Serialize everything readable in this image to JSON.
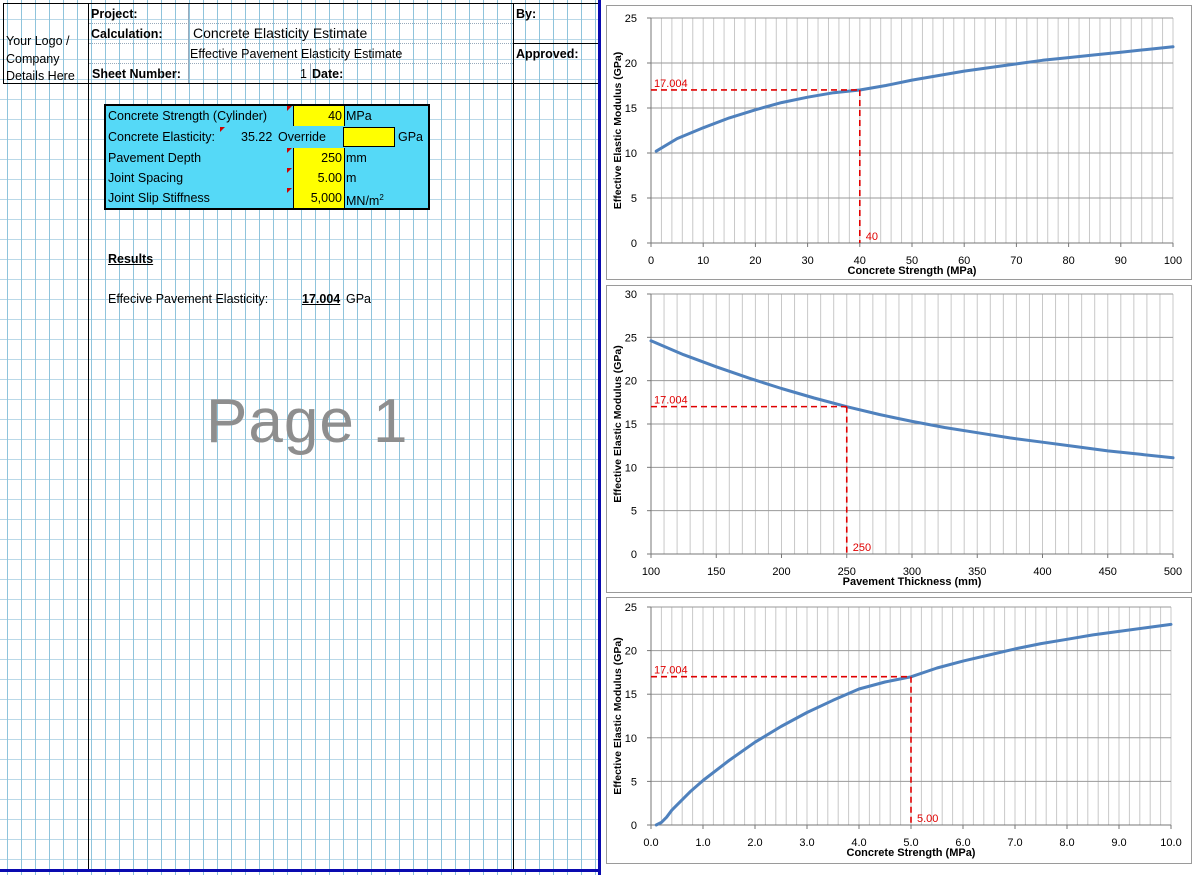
{
  "header": {
    "project_label": "Project:",
    "calculation_label": "Calculation:",
    "calculation_value": "Concrete Elasticity Estimate",
    "subtitle": "Effective Pavement Elasticity Estimate",
    "sheet_number_label": "Sheet Number:",
    "sheet_number_value": "1",
    "date_label": "Date:",
    "by_label": "By:",
    "approved_label": "Approved:",
    "logo_line1": "Your Logo /",
    "logo_line2": "Company",
    "logo_line3": "Details Here"
  },
  "inputs": {
    "rows": [
      {
        "label": "Concrete Strength (Cylinder)",
        "value": "40",
        "unit": "MPa"
      },
      {
        "label": "Concrete Elasticity:",
        "computed": "35.22",
        "override_label": "Override",
        "value": "",
        "unit": "GPa"
      },
      {
        "label": "Pavement Depth",
        "value": "250",
        "unit": "mm"
      },
      {
        "label": "Joint Spacing",
        "value": "5.00",
        "unit": "m"
      },
      {
        "label": "Joint Slip Stiffness",
        "value": "5,000",
        "unit": "MN/m",
        "unit_sup": "2"
      }
    ]
  },
  "results": {
    "heading": "Results",
    "label": "Effecive Pavement Elasticity:",
    "value": "17.004",
    "unit": "GPa"
  },
  "watermark": "Page 1",
  "colors": {
    "input_box": "#55d9f7",
    "input_cell": "#ffff00",
    "sheet_border": "#0a0ab0",
    "series_line": "#4f81bd",
    "marker_line": "#e00000"
  },
  "chart_data": [
    {
      "type": "line",
      "xlabel": "Concrete Strength (MPa)",
      "ylabel": "Effective Elastic Modulus  (GPa)",
      "xlim": [
        0,
        100
      ],
      "ylim": [
        0,
        25
      ],
      "xticks": [
        0,
        10,
        20,
        30,
        40,
        50,
        60,
        70,
        80,
        90,
        100
      ],
      "xtick_labels": [
        "0",
        "10",
        "20",
        "30",
        "40",
        "50",
        "60",
        "70",
        "80",
        "90",
        "100"
      ],
      "yticks": [
        0,
        5,
        10,
        15,
        20,
        25
      ],
      "ytick_labels": [
        "0",
        "5",
        "10",
        "15",
        "20",
        "25"
      ],
      "x_minor_step": 2,
      "series": [
        {
          "x": [
            1,
            5,
            10,
            15,
            20,
            25,
            30,
            35,
            40,
            45,
            50,
            55,
            60,
            65,
            70,
            75,
            80,
            85,
            90,
            95,
            100
          ],
          "y": [
            10.2,
            11.6,
            12.8,
            13.9,
            14.8,
            15.6,
            16.2,
            16.7,
            17.0,
            17.5,
            18.1,
            18.6,
            19.1,
            19.5,
            19.9,
            20.3,
            20.6,
            20.9,
            21.2,
            21.5,
            21.8
          ]
        }
      ],
      "marker": {
        "x": 40,
        "y": 17.004,
        "x_label": "40",
        "y_label": "17.004"
      }
    },
    {
      "type": "line",
      "xlabel": "Pavement Thickness  (mm)",
      "ylabel": "Effective Elastic Modulus  (GPa)",
      "xlim": [
        100,
        500
      ],
      "ylim": [
        0,
        30
      ],
      "xticks": [
        100,
        150,
        200,
        250,
        300,
        350,
        400,
        450,
        500
      ],
      "xtick_labels": [
        "100",
        "150",
        "200",
        "250",
        "300",
        "350",
        "400",
        "450",
        "500"
      ],
      "yticks": [
        0,
        5,
        10,
        15,
        20,
        25,
        30
      ],
      "ytick_labels": [
        "0",
        "5",
        "10",
        "15",
        "20",
        "25",
        "30"
      ],
      "x_minor_step": 10,
      "series": [
        {
          "x": [
            100,
            125,
            150,
            175,
            200,
            225,
            250,
            275,
            300,
            325,
            350,
            375,
            400,
            425,
            450,
            475,
            500
          ],
          "y": [
            24.6,
            23.0,
            21.6,
            20.3,
            19.1,
            18.0,
            17.0,
            16.1,
            15.3,
            14.6,
            14.0,
            13.4,
            12.9,
            12.4,
            11.9,
            11.5,
            11.1
          ]
        }
      ],
      "marker": {
        "x": 250,
        "y": 17.004,
        "x_label": "250",
        "y_label": "17.004"
      }
    },
    {
      "type": "line",
      "xlabel": "Concrete Strength (MPa)",
      "ylabel": "Effective Elastic Modulus  (GPa)",
      "xlim": [
        0,
        10
      ],
      "ylim": [
        0,
        25
      ],
      "xticks": [
        0,
        1,
        2,
        3,
        4,
        5,
        6,
        7,
        8,
        9,
        10
      ],
      "xtick_labels": [
        "0.0",
        "1.0",
        "2.0",
        "3.0",
        "4.0",
        "5.0",
        "6.0",
        "7.0",
        "8.0",
        "9.0",
        "10.0"
      ],
      "yticks": [
        0,
        5,
        10,
        15,
        20,
        25
      ],
      "ytick_labels": [
        "0",
        "5",
        "10",
        "15",
        "20",
        "25"
      ],
      "x_minor_step": 0.2,
      "series": [
        {
          "x": [
            0.1,
            0.2,
            0.3,
            0.4,
            0.5,
            0.75,
            1.0,
            1.5,
            2.0,
            2.5,
            3.0,
            3.5,
            4.0,
            4.5,
            5.0,
            5.5,
            6.0,
            6.5,
            7.0,
            7.5,
            8.0,
            8.5,
            9.0,
            9.5,
            10.0
          ],
          "y": [
            0.0,
            0.3,
            0.9,
            1.7,
            2.3,
            3.8,
            5.1,
            7.4,
            9.5,
            11.3,
            12.9,
            14.3,
            15.6,
            16.4,
            17.0,
            18.0,
            18.8,
            19.5,
            20.2,
            20.8,
            21.3,
            21.8,
            22.2,
            22.6,
            23.0
          ]
        }
      ],
      "marker": {
        "x": 5,
        "y": 17.004,
        "x_label": "5.00",
        "y_label": "17.004"
      }
    }
  ]
}
